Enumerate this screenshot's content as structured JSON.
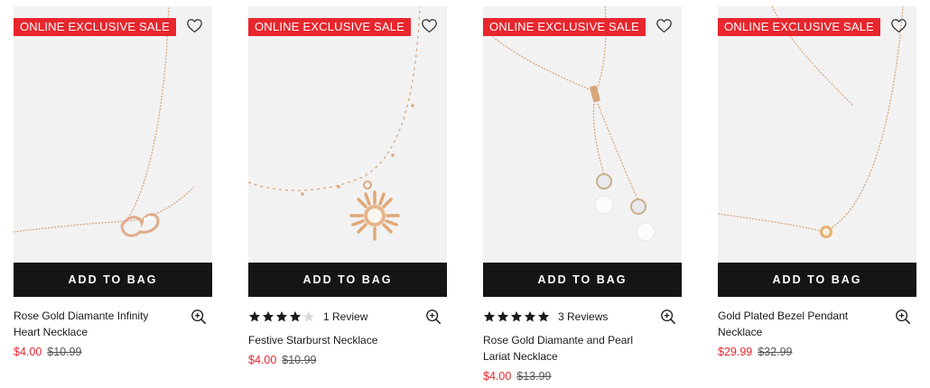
{
  "products": [
    {
      "badge": "ONLINE EXCLUSIVE SALE",
      "button": "ADD TO BAG",
      "name": "Rose Gold Diamante Infinity Heart Necklace",
      "rating": null,
      "reviews": "",
      "price_now": "$4.00",
      "price_was": "$10.99"
    },
    {
      "badge": "ONLINE EXCLUSIVE SALE",
      "button": "ADD TO BAG",
      "name": "Festive Starburst Necklace",
      "rating": 4,
      "reviews": "1 Review",
      "price_now": "$4.00",
      "price_was": "$10.99"
    },
    {
      "badge": "ONLINE EXCLUSIVE SALE",
      "button": "ADD TO BAG",
      "name": "Rose Gold Diamante and Pearl Lariat Necklace",
      "rating": 5,
      "reviews": "3 Reviews",
      "price_now": "$4.00",
      "price_was": "$13.99"
    },
    {
      "badge": "ONLINE EXCLUSIVE SALE",
      "button": "ADD TO BAG",
      "name": "Gold Plated Bezel Pendant Necklace",
      "rating": null,
      "reviews": "",
      "price_now": "$29.99",
      "price_was": "$32.99"
    }
  ],
  "colors": {
    "sale": "#e8262e",
    "button": "#151515",
    "image_bg": "#f2f2f2",
    "chain": "#d9a77c"
  },
  "icons": {
    "wishlist": "heart-outline-icon",
    "quick_view": "zoom-in-icon",
    "star": "star-icon"
  }
}
